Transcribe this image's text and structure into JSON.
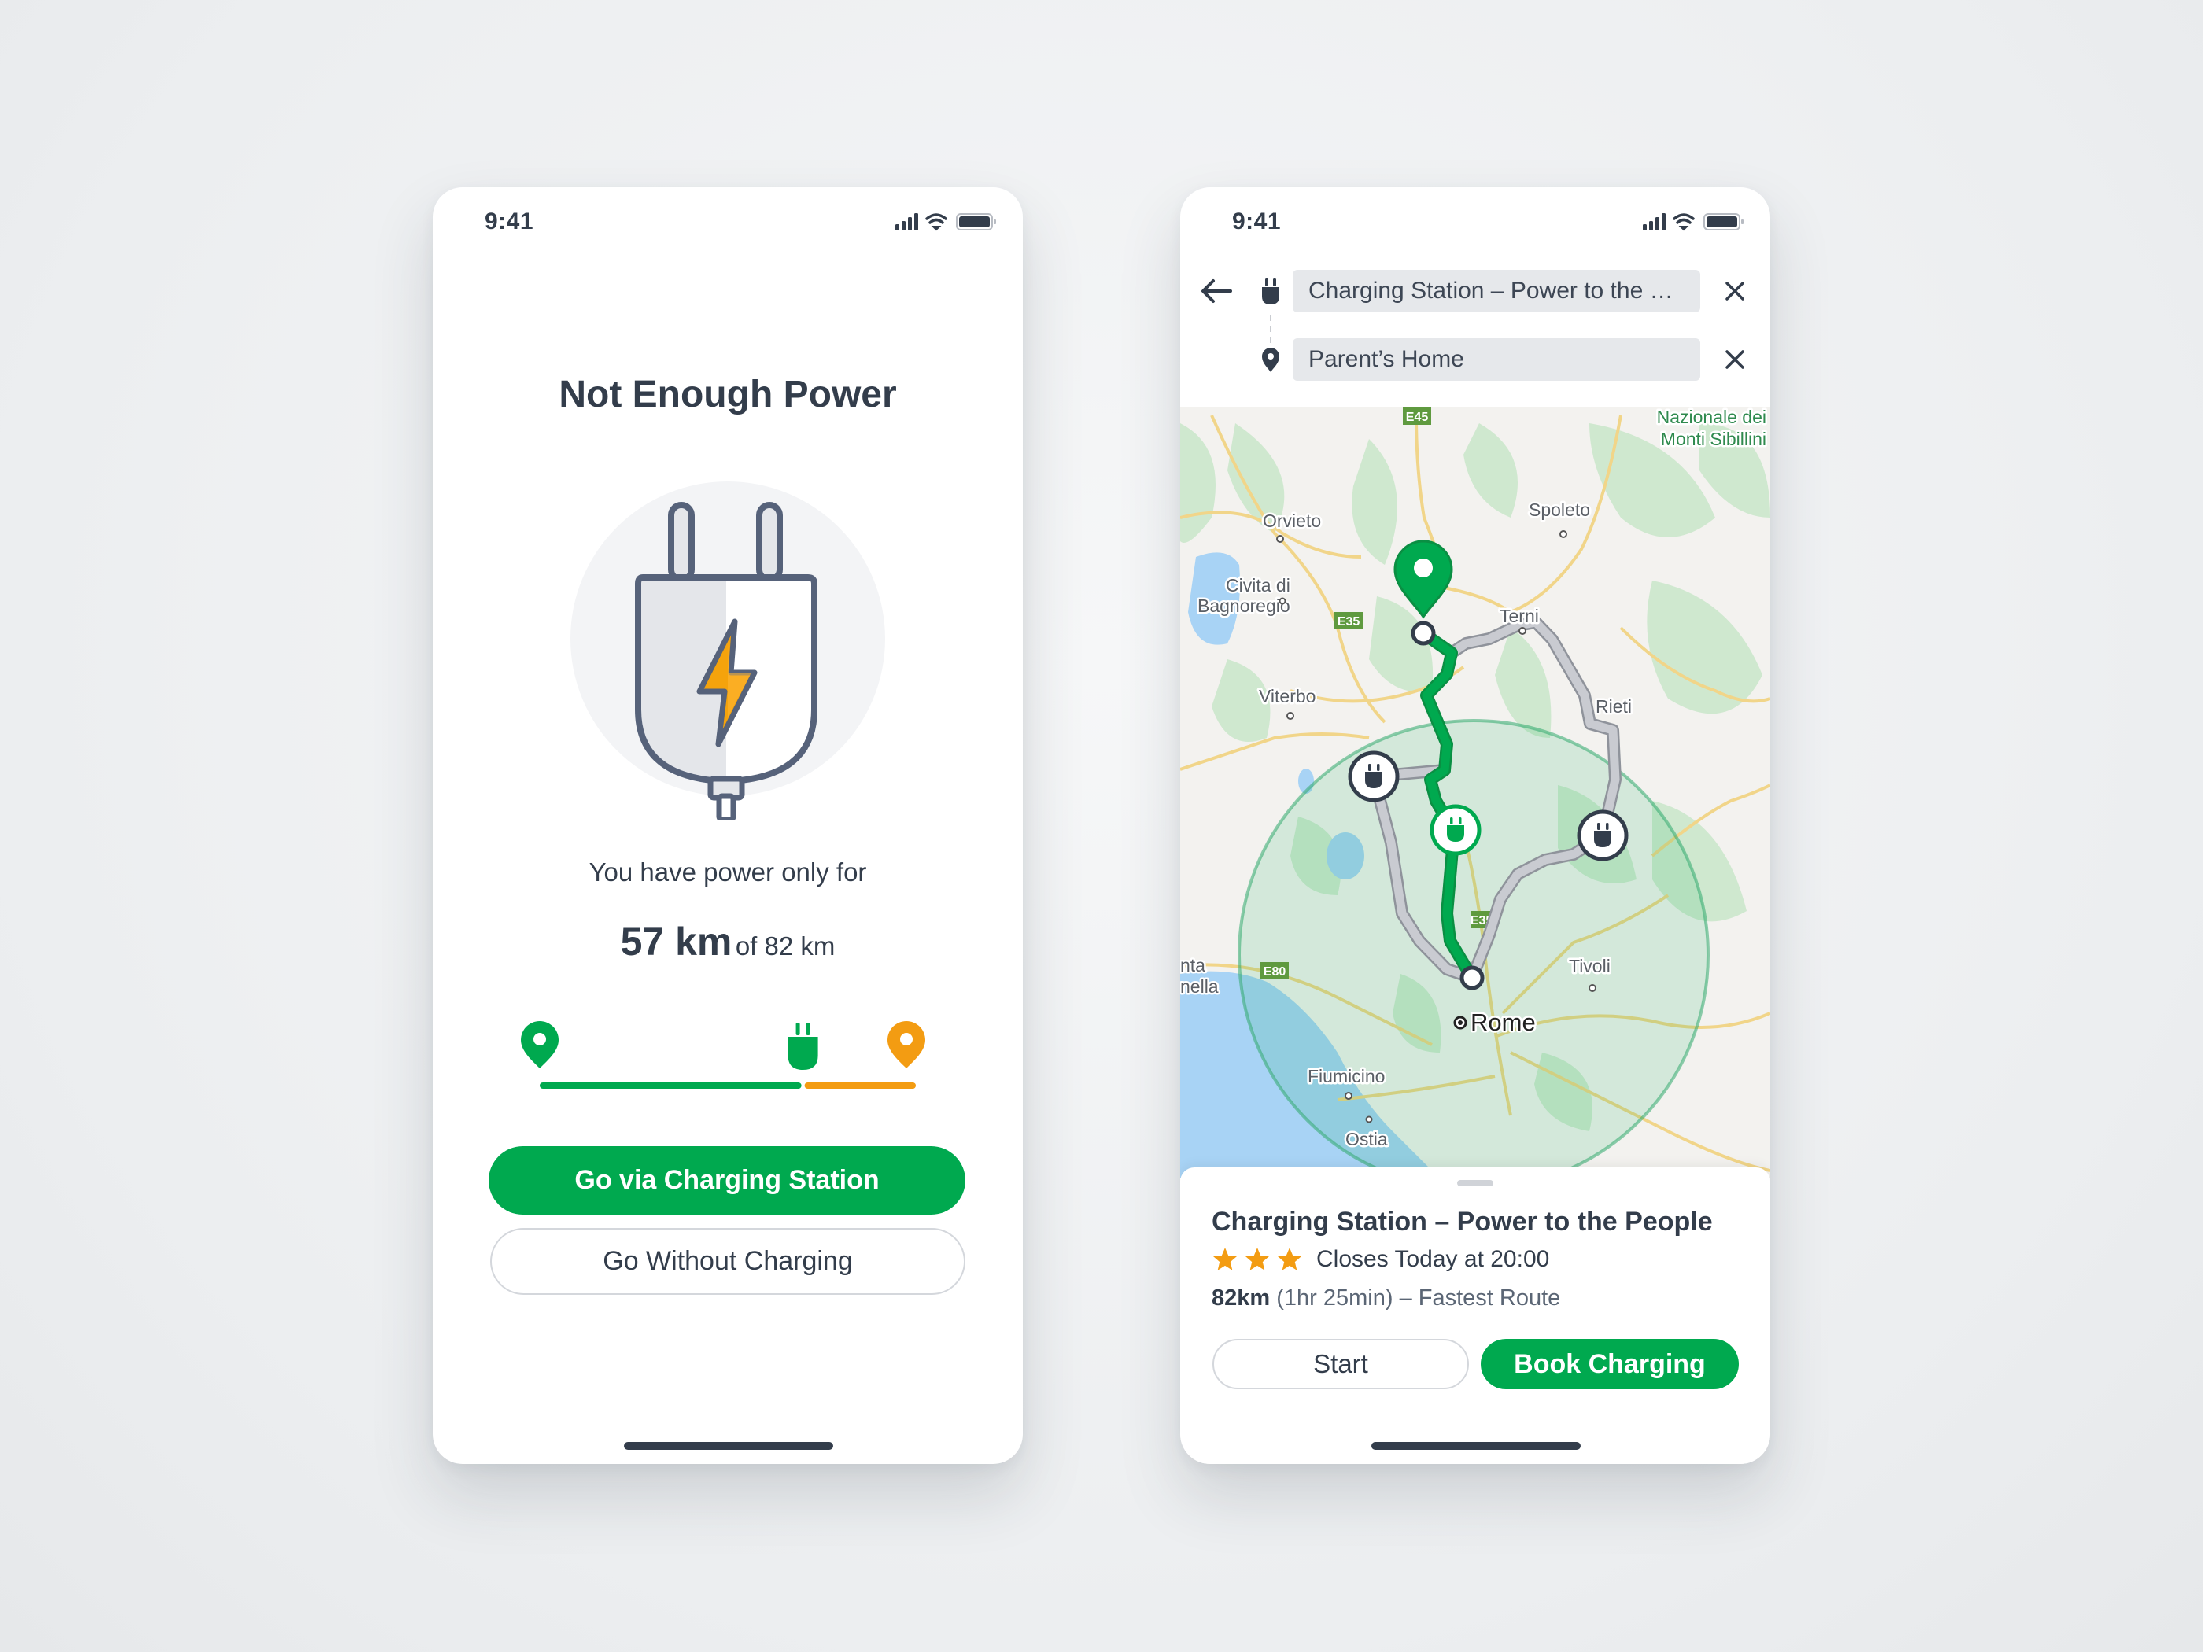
{
  "theme": {
    "accent_green": "#00a94f",
    "accent_orange": "#f39c12",
    "text_dark": "#333d4b",
    "route_grey": "#c5c8cf"
  },
  "left_screen": {
    "status_bar": {
      "time": "9:41",
      "icons": [
        "signal-icon",
        "wifi-icon",
        "battery-icon"
      ]
    },
    "title": "Not Enough Power",
    "illustration": "plug-with-lightning-icon",
    "subtitle": "You have power only for",
    "range": {
      "value": "57 km",
      "of_label": "of 82 km",
      "available_km": 57,
      "total_km": 82
    },
    "trip_progress": {
      "start_icon": "green-location-pin-icon",
      "charger_icon": "green-plug-icon",
      "end_icon": "orange-location-pin-icon",
      "reachable_fraction": 0.7,
      "reachable_color": "#00a94f",
      "remaining_color": "#f39c12"
    },
    "primary_button": "Go via Charging Station",
    "secondary_button": "Go Without Charging"
  },
  "right_screen": {
    "status_bar": {
      "time": "9:41",
      "icons": [
        "signal-icon",
        "wifi-icon",
        "battery-icon"
      ]
    },
    "route_inputs": {
      "from_value": "Charging Station – Power to the People",
      "to_value": "Parent’s Home"
    },
    "map": {
      "labels": {
        "park": [
          "Nazionale dei",
          "Monti Sibillini"
        ],
        "orvieto": "Orvieto",
        "spoleto": "Spoleto",
        "civita": [
          "Civita di",
          "Bagnoregio"
        ],
        "terni": "Terni",
        "viterbo": "Viterbo",
        "rieti": "Rieti",
        "tivoli": "Tivoli",
        "rome": "Rome",
        "fiumicino": "Fiumicino",
        "ostia": "Ostia",
        "edge": [
          "nta",
          "nella"
        ]
      },
      "highways": [
        "E45",
        "E35",
        "E80",
        "E35"
      ],
      "markers": [
        {
          "type": "destination-pin",
          "state": "selected"
        },
        {
          "type": "charging-station",
          "state": "selected"
        },
        {
          "type": "charging-station",
          "state": "default"
        },
        {
          "type": "charging-station",
          "state": "default"
        },
        {
          "type": "route-start",
          "state": "default"
        }
      ]
    },
    "station_sheet": {
      "title": "Charging Station – Power to the People",
      "rating": 3,
      "hours": "Closes Today at 20:00",
      "distance": "82km",
      "route_detail": "(1hr 25min) – Fastest Route",
      "start_button": "Start",
      "book_button": "Book Charging"
    }
  }
}
